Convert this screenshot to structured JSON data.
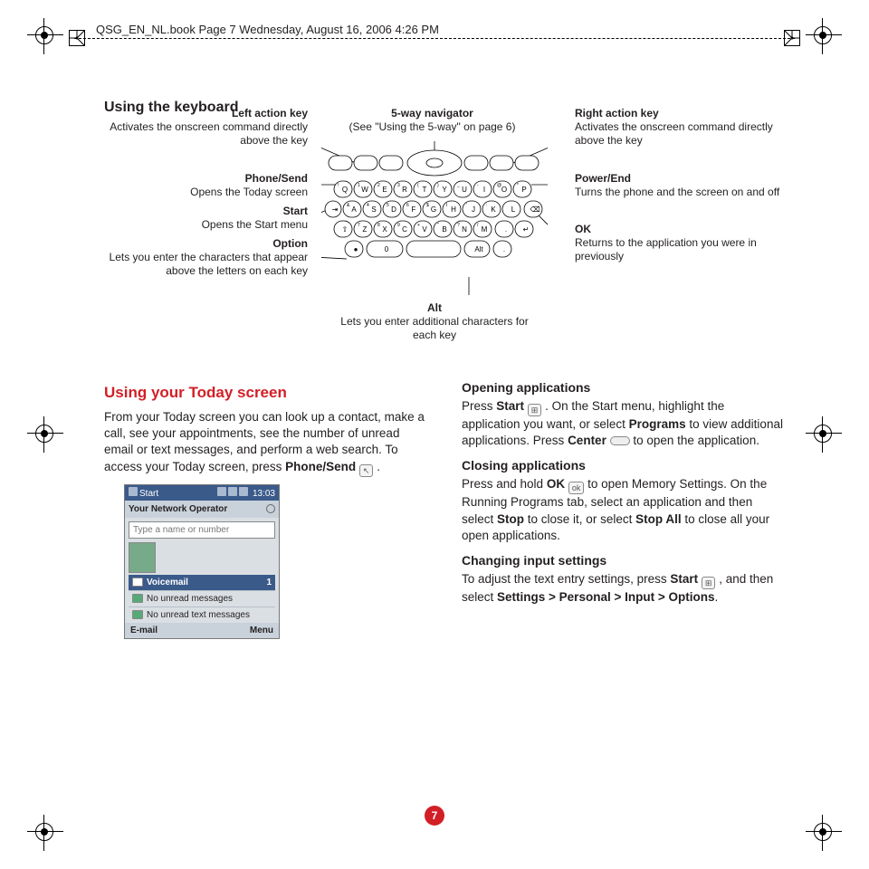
{
  "doc_header": "QSG_EN_NL.book  Page 7  Wednesday, August 16, 2006  4:26 PM",
  "page_number": "7",
  "h_using_kb": "Using the keyboard",
  "kb": {
    "nav": {
      "t": "5-way navigator",
      "d": "(See \"Using the 5-way\" on page 6)"
    },
    "left_action": {
      "t": "Left action key",
      "d": "Activates the onscreen command directly above the key"
    },
    "phone_send": {
      "t": "Phone/Send",
      "d": "Opens the Today screen"
    },
    "start": {
      "t": "Start",
      "d": "Opens the Start menu"
    },
    "option": {
      "t": "Option",
      "d": "Lets you enter the characters that appear above the letters on each key"
    },
    "right_action": {
      "t": "Right action key",
      "d": "Activates the onscreen command directly above the key"
    },
    "power_end": {
      "t": "Power/End",
      "d": "Turns the phone and the screen on and off"
    },
    "ok": {
      "t": "OK",
      "d": "Returns to the application you were in previously"
    },
    "alt": {
      "t": "Alt",
      "d": "Lets you enter additional characters for each key"
    },
    "keys": {
      "r1": [
        "Q",
        "W",
        "E",
        "R",
        "T",
        "Y",
        "U",
        "I",
        "O",
        "P"
      ],
      "r2": [
        "A",
        "S",
        "D",
        "F",
        "G",
        "H",
        "J",
        "K",
        "L"
      ],
      "r3": [
        "Z",
        "X",
        "C",
        "V",
        "B",
        "N",
        "M"
      ],
      "nums": [
        "!",
        "1",
        "2",
        "3",
        "(",
        ")",
        "_",
        "-",
        "@",
        "*",
        "&",
        "4",
        "5",
        "6",
        "$",
        "I",
        "'",
        ":",
        "7",
        "8",
        "9",
        "+",
        "\"",
        "?",
        "/"
      ],
      "space": "0",
      "alt": "Alt"
    }
  },
  "h_today": "Using your Today screen",
  "today_para_a": "From your Today screen you can look up a contact, make a call, see your appointments, see the number of unread email or text messages, and perform a web search. To access your Today screen, press ",
  "today_phone_send": "Phone/Send",
  "today_para_b": " .",
  "h_open": "Opening applications",
  "open_a": "Press ",
  "open_start": "Start",
  "open_b": " . On the Start menu, highlight the application you want, or select ",
  "open_programs": "Programs",
  "open_c": " to view additional applications. Press ",
  "open_center": "Center",
  "open_d": "  to open the application.",
  "h_close": "Closing applications",
  "close_a": "Press and hold ",
  "close_ok": "OK",
  "close_b": "  to open Memory Settings. On the Running Programs tab, select an application and then select ",
  "close_stop": "Stop",
  "close_c": " to close it, or select ",
  "close_stopall": "Stop All",
  "close_d": " to close all your open applications.",
  "h_input": "Changing input settings",
  "input_a": "To adjust the text entry settings, press ",
  "input_start": "Start",
  "input_b": " , and then select ",
  "input_path": "Settings > Personal > Input > Options",
  "input_c": ".",
  "ss": {
    "bar_left": "Start",
    "bar_right": "13:03",
    "operator": "Your Network Operator",
    "placeholder": "Type a name or number",
    "vm": "Voicemail",
    "row1": "No unread messages",
    "row2": "No unread text messages",
    "foot_l": "E-mail",
    "foot_r": "Menu"
  }
}
